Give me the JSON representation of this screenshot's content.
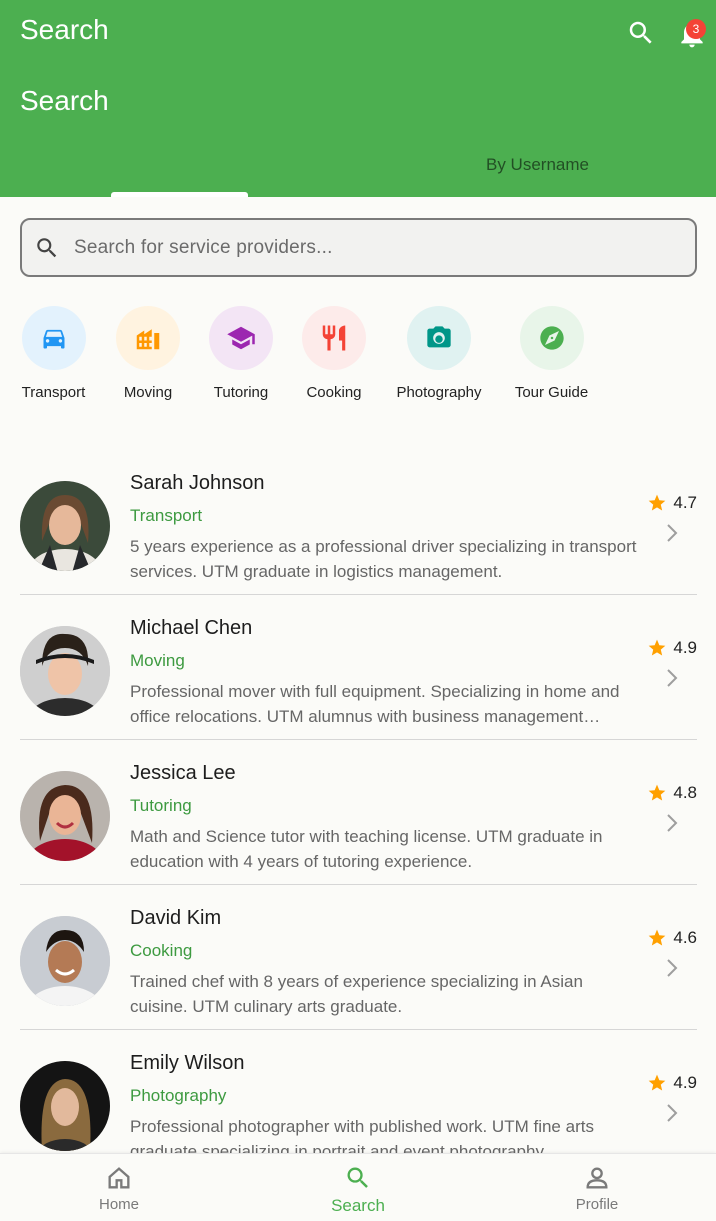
{
  "appbar": {
    "title": "Search",
    "notification_count": "3"
  },
  "header": {
    "section_title": "Search",
    "tabs": [
      {
        "label": "",
        "active": true
      },
      {
        "label": "By Username",
        "active": false
      }
    ]
  },
  "search": {
    "placeholder": "Search for service providers..."
  },
  "categories": [
    {
      "label": "Transport",
      "icon": "car-icon",
      "bg": "#e3f2fd",
      "color": "#2196f3"
    },
    {
      "label": "Moving",
      "icon": "moving-truck-icon",
      "bg": "#fff3e0",
      "color": "#ff9800"
    },
    {
      "label": "Tutoring",
      "icon": "graduation-cap-icon",
      "bg": "#f3e5f5",
      "color": "#9c27b0"
    },
    {
      "label": "Cooking",
      "icon": "utensils-icon",
      "bg": "#fdebea",
      "color": "#f44336"
    },
    {
      "label": "Photography",
      "icon": "camera-icon",
      "bg": "#e0f2f1",
      "color": "#009688"
    },
    {
      "label": "Tour Guide",
      "icon": "compass-icon",
      "bg": "#e8f5e9",
      "color": "#4caf50"
    }
  ],
  "providers": [
    {
      "name": "Sarah Johnson",
      "category": "Transport",
      "description": "5 years experience as a professional driver specializing in transport services. UTM graduate in logistics management.",
      "rating": "4.7"
    },
    {
      "name": "Michael Chen",
      "category": "Moving",
      "description": "Professional mover with full equipment. Specializing in home and office relocations. UTM alumnus with business management degree.",
      "rating": "4.9"
    },
    {
      "name": "Jessica Lee",
      "category": "Tutoring",
      "description": "Math and Science tutor with teaching license. UTM graduate in education with 4 years of tutoring experience.",
      "rating": "4.8"
    },
    {
      "name": "David Kim",
      "category": "Cooking",
      "description": "Trained chef with 8 years of experience specializing in Asian cuisine. UTM culinary arts graduate.",
      "rating": "4.6"
    },
    {
      "name": "Emily Wilson",
      "category": "Photography",
      "description": "Professional photographer with published work. UTM fine arts graduate specializing in portrait and event photography.",
      "rating": "4.9"
    }
  ],
  "bottom_nav": [
    {
      "label": "Home",
      "icon": "home-icon",
      "active": false
    },
    {
      "label": "Search",
      "icon": "search-icon",
      "active": true
    },
    {
      "label": "Profile",
      "icon": "person-icon",
      "active": false
    }
  ],
  "colors": {
    "primary": "#4caf50",
    "accent_text": "#3d9a40",
    "star": "#ffa000",
    "badge": "#f44336"
  }
}
